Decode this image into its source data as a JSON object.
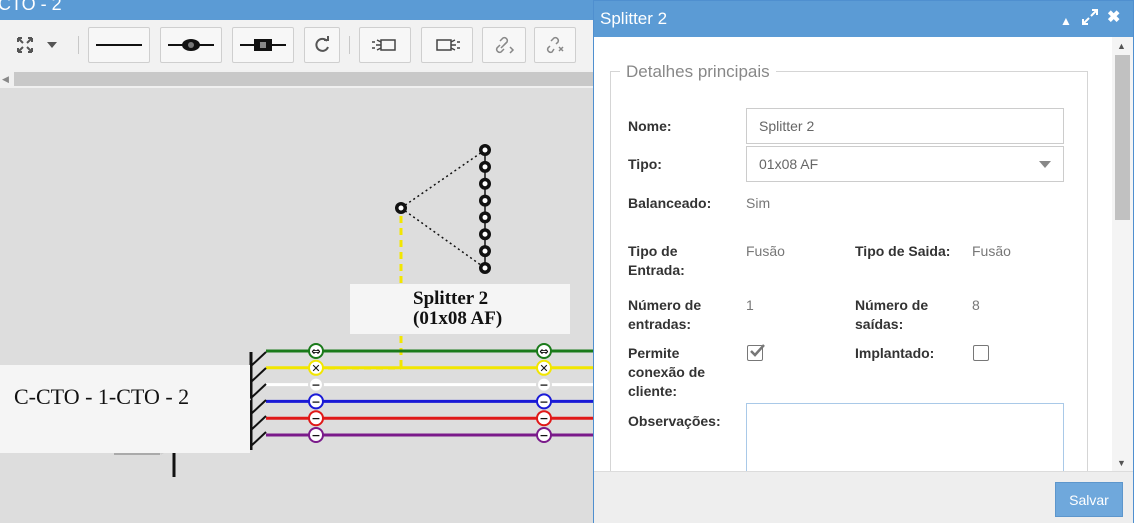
{
  "window": {
    "title": "CTO - 2"
  },
  "toolbar": {
    "buttons": [
      {
        "name": "fit-view",
        "icon": "expand-arrows-icon"
      },
      {
        "name": "line-tool",
        "icon": "line-icon"
      },
      {
        "name": "fusion-tool",
        "icon": "fusion-icon"
      },
      {
        "name": "connector-tool",
        "icon": "connector-icon"
      },
      {
        "name": "rotate",
        "icon": "rotate-icon"
      },
      {
        "name": "input-tool",
        "icon": "plug-in-icon"
      },
      {
        "name": "output-tool",
        "icon": "plug-out-icon"
      },
      {
        "name": "link",
        "icon": "link-icon"
      },
      {
        "name": "unlink",
        "icon": "unlink-icon"
      }
    ]
  },
  "diagram": {
    "splitter": {
      "name": "Splitter 2",
      "type": "(01x08 AF)",
      "input_port": "1",
      "output_ports": [
        "1",
        "2",
        "3",
        "4",
        "5",
        "6",
        "7",
        "8"
      ]
    },
    "cable": {
      "label": "C-CTO - 1-CTO - 2"
    },
    "fibers": [
      {
        "color": "#1a7a1a",
        "mark": "⇔"
      },
      {
        "color": "#f2e600",
        "mark": "✕"
      },
      {
        "color": "#ffffff",
        "mark": "−"
      },
      {
        "color": "#1a1ad6",
        "mark": "−"
      },
      {
        "color": "#e01818",
        "mark": "−"
      },
      {
        "color": "#7a1a8a",
        "mark": "−"
      }
    ]
  },
  "dialog": {
    "title": "Splitter 2",
    "section_title": "Detalhes principais",
    "fields": {
      "nome_label": "Nome:",
      "nome_value": "Splitter 2",
      "tipo_label": "Tipo:",
      "tipo_value": "01x08 AF",
      "balanceado_label": "Balanceado:",
      "balanceado_value": "Sim",
      "tipo_entrada_label": "Tipo de Entrada:",
      "tipo_entrada_value": "Fusão",
      "tipo_saida_label": "Tipo de Saida:",
      "tipo_saida_value": "Fusão",
      "num_entradas_label": "Número de entradas:",
      "num_entradas_value": "1",
      "num_saidas_label": "Número de saídas:",
      "num_saidas_value": "8",
      "permite_label": "Permite conexão de cliente:",
      "permite_checked": true,
      "implantado_label": "Implantado:",
      "implantado_checked": false,
      "observacoes_label": "Observações:",
      "observacoes_value": ""
    },
    "save_label": "Salvar"
  }
}
